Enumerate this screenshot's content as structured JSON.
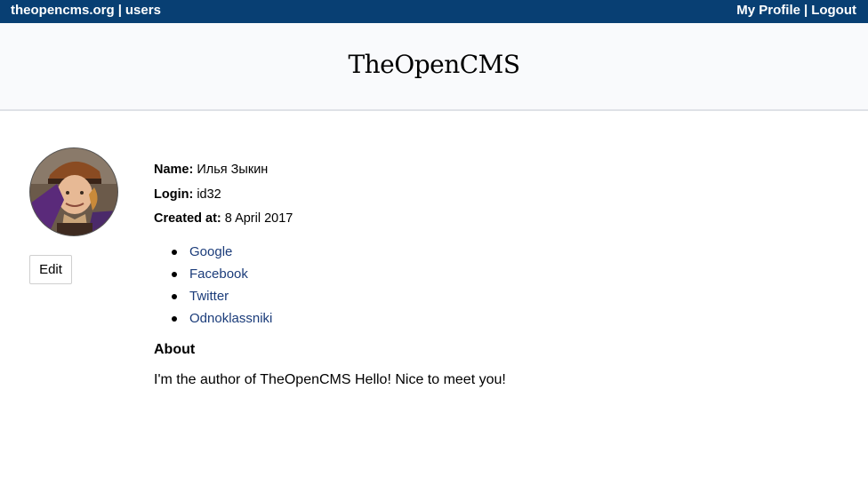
{
  "topbar": {
    "site_link": "theopencms.org",
    "separator": "|",
    "users_link": "users",
    "my_profile": "My Profile",
    "logout": "Logout",
    "background_color": "#083f73"
  },
  "header": {
    "site_title": "TheOpenCMS"
  },
  "profile": {
    "avatar_icon": "user-avatar-photo",
    "edit_label": "Edit",
    "name_label": "Name:",
    "name_value": "Илья Зыкин",
    "login_label": "Login:",
    "login_value": "id32",
    "created_label": "Created at:",
    "created_value": "8 April 2017"
  },
  "social_links": [
    {
      "label": "Google"
    },
    {
      "label": "Facebook"
    },
    {
      "label": "Twitter"
    },
    {
      "label": "Odnoklassniki"
    }
  ],
  "about": {
    "heading": "About",
    "text": "I'm the author of TheOpenCMS Hello! Nice to meet you!"
  },
  "colors": {
    "link": "#1b3c7a",
    "header_bg": "#f9fafc"
  }
}
